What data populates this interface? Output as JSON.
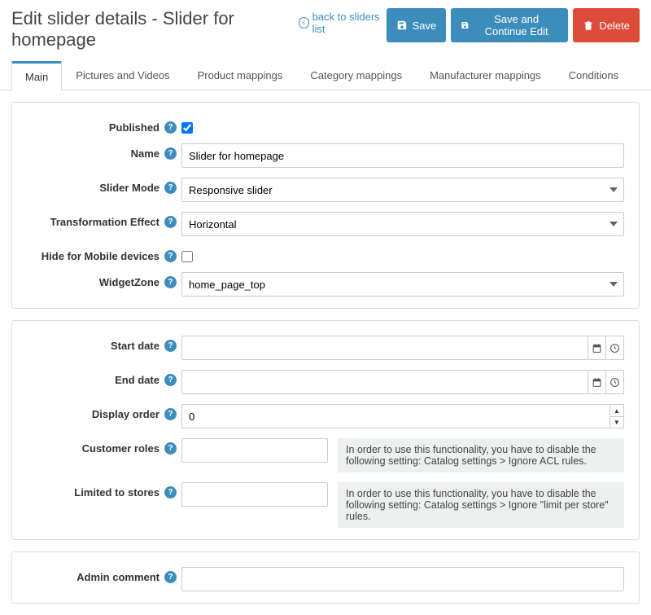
{
  "header": {
    "title": "Edit slider details - Slider for homepage",
    "back_label": "back to sliders list",
    "buttons": {
      "save": "Save",
      "save_continue": "Save and Continue Edit",
      "delete": "Delete"
    }
  },
  "tabs": [
    "Main",
    "Pictures and Videos",
    "Product mappings",
    "Category mappings",
    "Manufacturer mappings",
    "Conditions"
  ],
  "active_tab": 0,
  "form": {
    "published": {
      "label": "Published",
      "checked": true
    },
    "name": {
      "label": "Name",
      "value": "Slider for homepage"
    },
    "slider_mode": {
      "label": "Slider Mode",
      "value": "Responsive slider"
    },
    "transformation_effect": {
      "label": "Transformation Effect",
      "value": "Horizontal"
    },
    "hide_mobile": {
      "label": "Hide for Mobile devices",
      "checked": false
    },
    "widget_zone": {
      "label": "WidgetZone",
      "value": "home_page_top"
    },
    "start_date": {
      "label": "Start date",
      "value": ""
    },
    "end_date": {
      "label": "End date",
      "value": ""
    },
    "display_order": {
      "label": "Display order",
      "value": "0"
    },
    "customer_roles": {
      "label": "Customer roles",
      "hint": "In order to use this functionality, you have to disable the following setting: Catalog settings > Ignore ACL rules."
    },
    "limited_stores": {
      "label": "Limited to stores",
      "hint": "In order to use this functionality, you have to disable the following setting: Catalog settings > Ignore \"limit per store\" rules."
    },
    "admin_comment": {
      "label": "Admin comment",
      "value": ""
    }
  }
}
